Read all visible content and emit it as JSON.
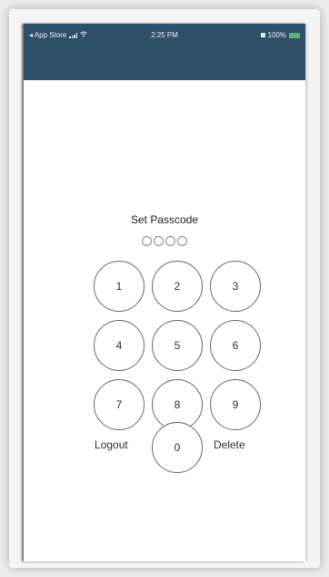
{
  "status_bar": {
    "back_label": "◂ App Store",
    "time": "2:25 PM",
    "battery_percent": "100%"
  },
  "passcode": {
    "title": "Set Passcode",
    "digits_length": 4,
    "keys": [
      "1",
      "2",
      "3",
      "4",
      "5",
      "6",
      "7",
      "8",
      "9",
      "0"
    ],
    "logout_label": "Logout",
    "delete_label": "Delete"
  },
  "colors": {
    "header": "#2f5069",
    "battery": "#56c35e"
  }
}
